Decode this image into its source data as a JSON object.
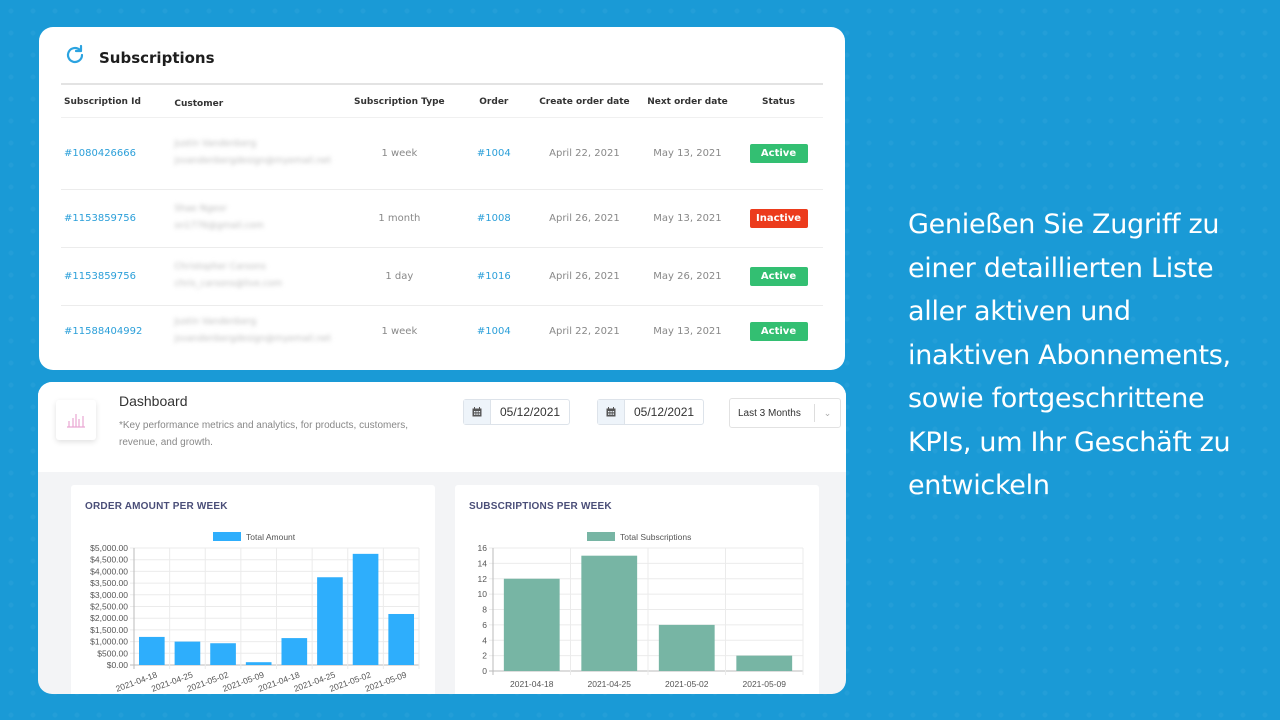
{
  "subscriptions": {
    "title": "Subscriptions",
    "icon": "refresh-icon",
    "columns": [
      "Subscription Id",
      "Customer",
      "Subscription Type",
      "Order",
      "Create order date",
      "Next order date",
      "Status"
    ],
    "rows": [
      {
        "id": "#1080426666",
        "customer_name": "Justin Vandenberg",
        "customer_email": "jsvandenbergdesign@myemail.net",
        "type": "1 week",
        "order": "#1004",
        "created": "April 22, 2021",
        "next": "May 13, 2021",
        "status": "Active"
      },
      {
        "id": "#1153859756",
        "customer_name": "Shae Ngeor",
        "customer_email": "sn1776@gmail.com",
        "type": "1 month",
        "order": "#1008",
        "created": "April 26, 2021",
        "next": "May 13, 2021",
        "status": "Inactive"
      },
      {
        "id": "#1153859756",
        "customer_name": "Christopher Carsons",
        "customer_email": "chris_carsons@live.com",
        "type": "1 day",
        "order": "#1016",
        "created": "April 26, 2021",
        "next": "May 26, 2021",
        "status": "Active"
      },
      {
        "id": "#11588404992",
        "customer_name": "Justin Vandenberg",
        "customer_email": "jsvandenbergdesign@myemail.net",
        "type": "1 week",
        "order": "#1004",
        "created": "April 22, 2021",
        "next": "May 13, 2021",
        "status": "Active"
      }
    ],
    "colors": {
      "link": "#2b9fd9",
      "active": "#33bf72",
      "inactive": "#ec3b1c"
    }
  },
  "dashboard": {
    "title": "Dashboard",
    "description": "*Key performance metrics and analytics, for products, customers, revenue, and growth.",
    "date_from": "05/12/2021",
    "date_to": "05/12/2021",
    "range_select": "Last 3 Months"
  },
  "promo_text": "Genießen Sie Zugriff zu einer detaillierten Liste aller aktiven und inaktiven Abonnements, sowie fortgeschrittene KPIs, um Ihr Geschäft zu entwickeln",
  "chart_data": [
    {
      "type": "bar",
      "title": "ORDER AMOUNT PER WEEK",
      "legend": "Total Amount",
      "legend_position": "top",
      "color": "#2eaefc",
      "categories": [
        "2021-04-18",
        "2021-04-25",
        "2021-05-02",
        "2021-05-09",
        "2021-04-18",
        "2021-04-25",
        "2021-05-02",
        "2021-05-09"
      ],
      "values": [
        1200,
        1000,
        930,
        120,
        1150,
        3750,
        4750,
        2180
      ],
      "yticks": [
        "$0.00",
        "$500.00",
        "$1,000.00",
        "$1,500.00",
        "$2,000.00",
        "$2,500.00",
        "$3,000.00",
        "$3,500.00",
        "$4,000.00",
        "$4,500.00",
        "$5,000.00"
      ],
      "ylim": [
        0,
        5000
      ],
      "grid": true
    },
    {
      "type": "bar",
      "title": "SUBSCRIPTIONS PER WEEK",
      "legend": "Total Subscriptions",
      "legend_position": "top",
      "color": "#77b5a4",
      "categories": [
        "2021-04-18",
        "2021-04-25",
        "2021-05-02",
        "2021-05-09"
      ],
      "values": [
        12,
        15,
        6,
        2
      ],
      "yticks": [
        "0",
        "2",
        "4",
        "6",
        "8",
        "10",
        "12",
        "14",
        "16"
      ],
      "ylim": [
        0,
        16
      ],
      "grid": true
    }
  ]
}
